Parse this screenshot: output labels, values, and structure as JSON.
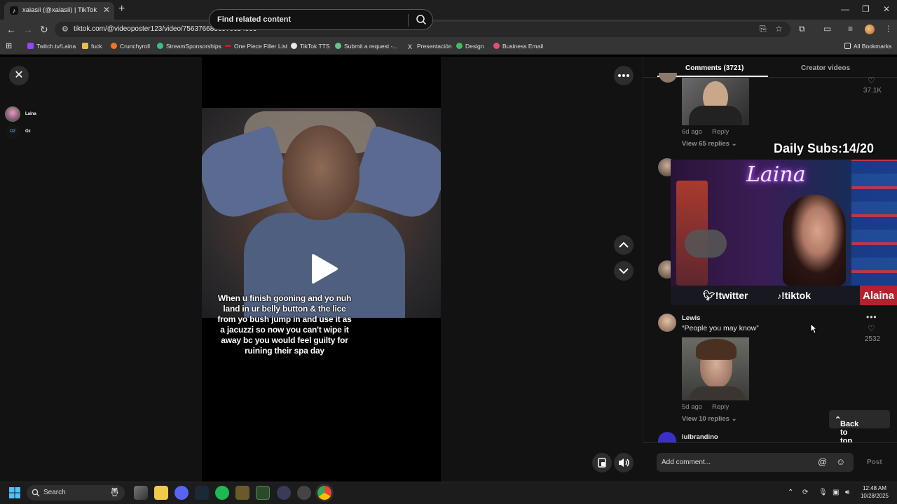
{
  "browser": {
    "tab_title": "xaiasii (@xaiasii) | TikTok",
    "url": "tiktok.com/@videoposter123/video/7563766836970654999",
    "bookmarks": [
      {
        "label": "Twitch.tv/Laina",
        "color": "#9146ff"
      },
      {
        "label": "fuck",
        "color": "#e0c050"
      },
      {
        "label": "Crunchyroll",
        "color": "#f47521"
      },
      {
        "label": "StreamSponsorships",
        "color": "#3fbf7f"
      },
      {
        "label": "One Piece Filler List",
        "color": "#c02020"
      },
      {
        "label": "TikTok TTS",
        "color": "#e8e8e8"
      },
      {
        "label": "Submit a request -...",
        "color": "#5fc98a"
      },
      {
        "label": "Presentación",
        "color": "#e8e8e8"
      },
      {
        "label": "Design",
        "color": "#3fbf5f"
      },
      {
        "label": "Business Email",
        "color": "#e05070"
      }
    ],
    "all_bookmarks": "All Bookmarks"
  },
  "left": {
    "accounts": [
      {
        "label": "Laina"
      },
      {
        "label": "Oz"
      }
    ]
  },
  "search": {
    "placeholder": "Find related content"
  },
  "video": {
    "caption": "When u finish gooning and yo nuh land in ur belly button & the lice from yo bush jump in and use it as a jacuzzi so now you can't wipe it away bc you would feel guilty for ruining their spa day"
  },
  "comments_panel": {
    "tab_comments": "Comments (3721)",
    "tab_creator": "Creator videos",
    "items": [
      {
        "likes": "37.1K",
        "meta_date": "6d ago",
        "reply": "Reply",
        "view_replies": "View 65 replies"
      },
      {
        "name": "Lewis",
        "text": "“People you may know”",
        "likes": "2532",
        "meta_date": "5d ago",
        "reply": "Reply",
        "view_replies": "View 10 replies"
      },
      {
        "name": "lulbrandino"
      }
    ],
    "back_to_top": "Back to top",
    "add_comment_placeholder": "Add comment...",
    "post": "Post"
  },
  "stream_overlay": {
    "subs": "Daily Subs:14/20",
    "neon": "Laina",
    "twitter": "!twitter",
    "tiktok": "!tiktok",
    "name": "Alaina"
  },
  "taskbar": {
    "search": "Search",
    "time": "12:48 AM",
    "date": "10/28/2025"
  }
}
